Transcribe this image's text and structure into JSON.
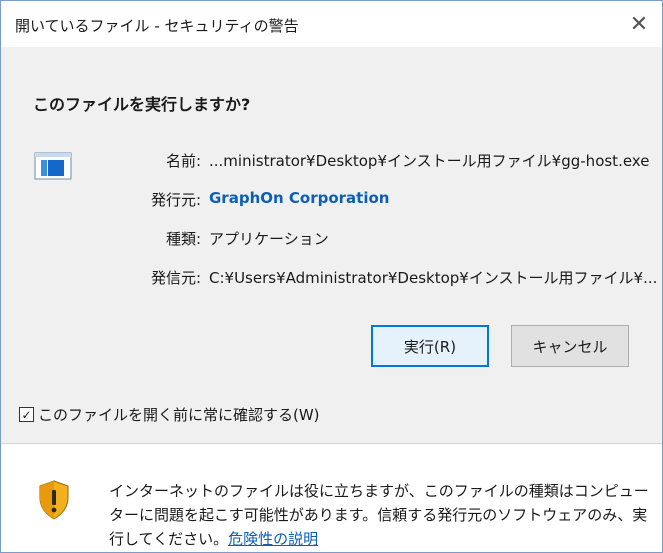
{
  "window": {
    "title": "開いているファイル - セキュリティの警告",
    "close_glyph": "✕"
  },
  "prompt": {
    "question": "このファイルを実行しますか?"
  },
  "details": {
    "name_label": "名前:",
    "name_value": "...ministrator¥Desktop¥インストール用ファイル¥gg-host.exe",
    "publisher_label": "発行元:",
    "publisher_value": "GraphOn Corporation",
    "type_label": "種類:",
    "type_value": "アプリケーション",
    "from_label": "発信元:",
    "from_value": "C:¥Users¥Administrator¥Desktop¥インストール用ファイル¥..."
  },
  "buttons": {
    "run_label": "実行(R)",
    "cancel_label": "キャンセル"
  },
  "checkbox": {
    "label": "このファイルを開く前に常に確認する(W)",
    "checked": true,
    "check_glyph": "✓"
  },
  "footer": {
    "warning_text": "インターネットのファイルは役に立ちますが、このファイルの種類はコンピューターに問題を起こす可能性があります。信頼する発行元のソフトウェアのみ、実行してください。",
    "link_text": "危険性の説明"
  },
  "icons": {
    "file": "application-file-icon",
    "shield": "security-shield-warning-icon"
  },
  "colors": {
    "link": "#0b5fb5",
    "primary_button_border": "#0078d7",
    "dialog_background": "#f0f0f0"
  }
}
